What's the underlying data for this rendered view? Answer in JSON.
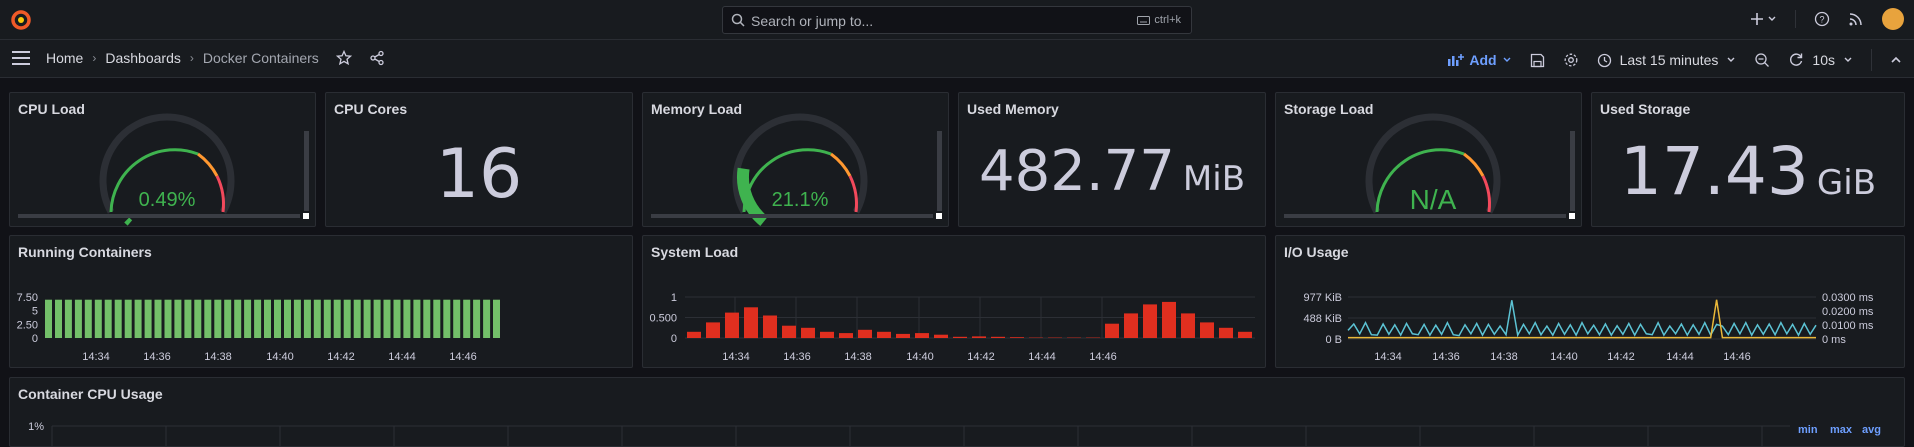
{
  "search": {
    "placeholder": "Search or jump to...",
    "shortcut": "ctrl+k"
  },
  "breadcrumb": {
    "home": "Home",
    "dashboards": "Dashboards",
    "current": "Docker Containers"
  },
  "toolbar": {
    "add_label": "Add",
    "time_range": "Last 15 minutes",
    "refresh_interval": "10s"
  },
  "colors": {
    "green": "#3fb34f",
    "orange": "#ff9830",
    "red": "#f2495c",
    "bar_green": "#73bf69",
    "bar_red": "#e02f1f",
    "line_blue": "#5cc3d4",
    "line_yellow": "#eab839",
    "link_blue": "#6e9fff"
  },
  "panels": {
    "cpu_load": {
      "title": "CPU Load",
      "value": "0.49%",
      "fraction": 0.0049
    },
    "cpu_cores": {
      "title": "CPU Cores",
      "value": "16"
    },
    "memory_load": {
      "title": "Memory Load",
      "value": "21.1%",
      "fraction": 0.211
    },
    "used_memory": {
      "title": "Used Memory",
      "value": "482.77",
      "unit": "MiB"
    },
    "storage_load": {
      "title": "Storage Load",
      "value": "N/A"
    },
    "used_storage": {
      "title": "Used Storage",
      "value": "17.43",
      "unit": "GiB"
    },
    "running_containers": {
      "title": "Running Containers"
    },
    "system_load": {
      "title": "System Load"
    },
    "io_usage": {
      "title": "I/O Usage"
    },
    "container_cpu": {
      "title": "Container CPU Usage",
      "y_tick": "1%",
      "legend": [
        "min",
        "max",
        "avg"
      ]
    }
  },
  "chart_data": [
    {
      "type": "bar",
      "title": "Running Containers",
      "y_ticks": [
        "7.50",
        "5",
        "2.50",
        "0"
      ],
      "ylim": [
        0,
        7.5
      ],
      "x_ticks": [
        "14:34",
        "14:36",
        "14:38",
        "14:40",
        "14:42",
        "14:44",
        "14:46"
      ],
      "values": [
        7,
        7,
        7,
        7,
        7,
        7,
        7,
        7,
        7,
        7,
        7,
        7,
        7,
        7,
        7,
        7,
        7,
        7,
        7,
        7,
        7,
        7,
        7,
        7,
        7,
        7,
        7,
        7,
        7,
        7,
        7,
        7,
        7,
        7,
        7,
        7,
        7,
        7,
        7,
        7,
        7,
        7,
        7,
        7,
        7,
        7
      ]
    },
    {
      "type": "bar",
      "title": "System Load",
      "y_ticks": [
        "1",
        "0.500",
        "0"
      ],
      "ylim": [
        0,
        1
      ],
      "x_ticks": [
        "14:34",
        "14:36",
        "14:38",
        "14:40",
        "14:42",
        "14:44",
        "14:46"
      ],
      "values": [
        0.15,
        0.38,
        0.62,
        0.75,
        0.55,
        0.3,
        0.25,
        0.15,
        0.12,
        0.2,
        0.15,
        0.1,
        0.12,
        0.08,
        0.03,
        0.04,
        0.03,
        0.02,
        0.01,
        0.01,
        0.01,
        0.01,
        0.35,
        0.6,
        0.82,
        0.88,
        0.6,
        0.38,
        0.25,
        0.15
      ]
    },
    {
      "type": "line",
      "title": "I/O Usage",
      "y_ticks_left": [
        "977 KiB",
        "488 KiB",
        "0 B"
      ],
      "y_ticks_right": [
        "0.0300 ms",
        "0.0200 ms",
        "0.0100 ms",
        "0 ms"
      ],
      "x_ticks": [
        "14:34",
        "14:36",
        "14:38",
        "14:40",
        "14:42",
        "14:44",
        "14:46"
      ],
      "ylim_left_kib": [
        0,
        977
      ],
      "series": [
        {
          "axis": "left",
          "color": "#5cc3d4",
          "values": [
            200,
            350,
            120,
            380,
            100,
            90,
            350,
            110,
            330,
            90,
            360,
            120,
            100,
            340,
            90,
            320,
            110,
            380,
            100,
            80,
            330,
            120,
            360,
            90,
            340,
            110,
            300,
            100,
            900,
            90,
            340,
            120,
            380,
            100,
            300,
            90,
            360,
            110,
            330,
            90,
            380,
            120,
            320,
            100,
            350,
            90,
            310,
            110,
            360,
            90,
            340,
            120,
            100,
            380,
            90,
            300,
            120,
            350,
            90,
            330,
            110,
            380,
            90,
            340,
            300,
            100,
            360,
            120,
            380,
            90,
            330,
            110,
            350,
            100,
            380,
            120,
            340,
            90,
            360,
            110,
            320
          ]
        },
        {
          "axis": "right",
          "color": "#eab839",
          "values": [
            0.001,
            0.001,
            0.001,
            0.001,
            0.001,
            0.001,
            0.001,
            0.001,
            0.001,
            0.001,
            0.001,
            0.001,
            0.001,
            0.001,
            0.001,
            0.001,
            0.001,
            0.001,
            0.001,
            0.001,
            0.001,
            0.001,
            0.001,
            0.001,
            0.001,
            0.001,
            0.001,
            0.001,
            0.001,
            0.001,
            0.001,
            0.001,
            0.001,
            0.001,
            0.001,
            0.001,
            0.001,
            0.001,
            0.001,
            0.001,
            0.001,
            0.001,
            0.001,
            0.001,
            0.001,
            0.001,
            0.001,
            0.001,
            0.001,
            0.001,
            0.001,
            0.001,
            0.001,
            0.001,
            0.001,
            0.001,
            0.001,
            0.001,
            0.001,
            0.001,
            0.001,
            0.001,
            0.001,
            0.028,
            0.001,
            0.001,
            0.001,
            0.001,
            0.001,
            0.001,
            0.001,
            0.001,
            0.001,
            0.001,
            0.001,
            0.001,
            0.001,
            0.001,
            0.001,
            0.001,
            0.001
          ]
        }
      ]
    }
  ]
}
